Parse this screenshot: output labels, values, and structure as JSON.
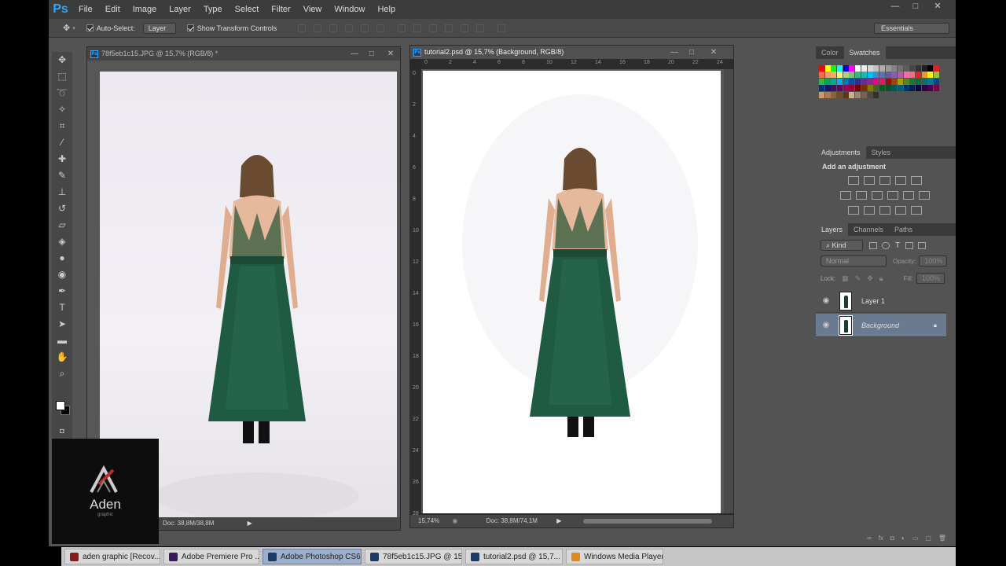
{
  "app": {
    "logo": "Ps",
    "menu": [
      "File",
      "Edit",
      "Image",
      "Layer",
      "Type",
      "Select",
      "Filter",
      "View",
      "Window",
      "Help"
    ],
    "window_controls": [
      "—",
      "□",
      "✕"
    ]
  },
  "options": {
    "auto_select_label": "Auto-Select:",
    "auto_select_value": "Layer",
    "transform_label": "Show Transform Controls",
    "workspace": "Essentials"
  },
  "doc1": {
    "title": "78f5eb1c15.JPG @ 15,7% (RGB/8) *",
    "status": "Doc: 38,8M/38,8M"
  },
  "doc2": {
    "title": "tutorial2.psd @ 15,7% (Background, RGB/8)",
    "zoom": "15,74%",
    "status": "Doc: 38,8M/74,1M",
    "ruler_h": [
      "0",
      "2",
      "4",
      "6",
      "8",
      "10",
      "12",
      "14",
      "16",
      "18",
      "20",
      "22",
      "24"
    ],
    "ruler_v": [
      "0",
      "2",
      "4",
      "6",
      "8",
      "10",
      "12",
      "14",
      "16",
      "18",
      "20",
      "22",
      "24",
      "26",
      "28"
    ]
  },
  "panels": {
    "color_tab": "Color",
    "swatches_tab": "Swatches",
    "adjustments_tab": "Adjustments",
    "styles_tab": "Styles",
    "add_adjustment": "Add an adjustment",
    "layers_tab": "Layers",
    "channels_tab": "Channels",
    "paths_tab": "Paths",
    "kind": "Kind",
    "blend": "Normal",
    "opacity_label": "Opacity:",
    "opacity_value": "100%",
    "lock_label": "Lock:",
    "fill_label": "Fill:",
    "fill_value": "100%"
  },
  "layers": [
    {
      "name": "Layer 1",
      "selected": false
    },
    {
      "name": "Background",
      "selected": true
    }
  ],
  "watermark": {
    "brand": "Aden",
    "tagline": "graphic"
  },
  "taskbar": [
    {
      "label": "aden graphic [Recov...",
      "color": "#8b1a1a"
    },
    {
      "label": "Adobe Premiere Pro ...",
      "color": "#3a1a5c"
    },
    {
      "label": "Adobe Photoshop CS6",
      "color": "#1c3a66"
    },
    {
      "label": "78f5eb1c15.JPG @ 15...",
      "color": "#1c3a66"
    },
    {
      "label": "tutorial2.psd @ 15,7...",
      "color": "#1c3a66"
    },
    {
      "label": "Windows Media Player",
      "color": "#e08a1a"
    }
  ]
}
